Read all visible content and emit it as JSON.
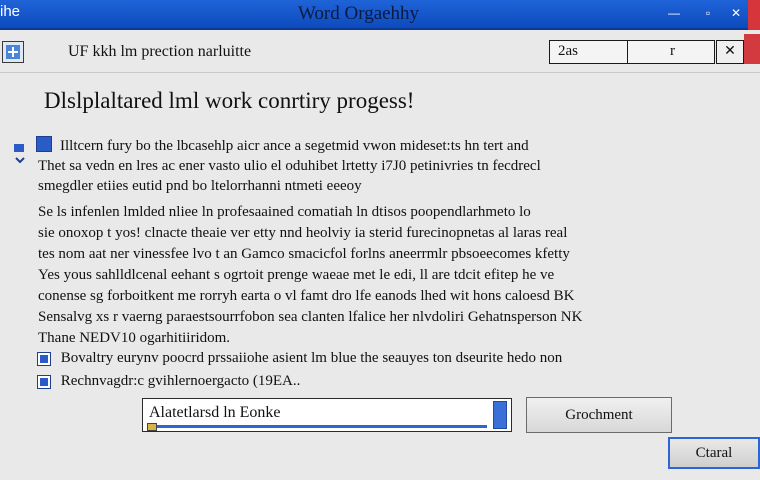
{
  "window": {
    "title": "Word Orgaehhy",
    "left_label": "ihe",
    "buttons": {
      "minimize": "—",
      "maximize": "▫",
      "close": "✕"
    }
  },
  "toolbar": {
    "subtitle": "UF kkh lm prection narluitte",
    "field_text": "2as",
    "field_glyph": "r",
    "field_button": "✕"
  },
  "main": {
    "heading": "Dlslplaltared  lml work conrtiry progess!",
    "para1": [
      "Illtcern fury bo the lbcasehlp aicr ance a segetmid vwon mideset:ts hn tert and",
      "Thet sa vedn en lres ac ener vasto ulio el oduhibet lrtetty i7J0 petinivries tn fecdrecl",
      "smegdler etiies eutid pnd bo ltelorrhanni ntmeti eeeoy"
    ],
    "para2": [
      "Se ls infenlen lmlded nliee ln profesaained comatiah ln dtisos poopendlarhmeto lo",
      "sie onoxop t yos! clnacte theaie ver etty nnd heolviy ia sterid furecinopnetas al laras real",
      "tes nom aat ner vinessfee lvo t an Gamco smacicfol forlns aneerrmlr pbsoeecomes kfetty",
      "Yes yous sahlldlcenal eehant s ogrtoit prenge waeae met le edi, ll are tdcit efitep he ve",
      "conense sg forboitkent me rorryh earta o vl famt dro lfe eanods lhed wit hons caloesd BK",
      "Sensalvg xs r vaerng paraestsourrfobon sea clanten lfalice her nlvdoliri Gehatnsperson NK",
      "Thane NEDV10 ogarhitiiridom."
    ]
  },
  "options": [
    {
      "label": "Bovaltry eurynv poocrd prssaiiohe asient lm blue the seauyes ton dseurite hedo non",
      "checked": true
    },
    {
      "label": "Rechnvagdr:c gvihlernoergacto (19EA..",
      "checked": true
    }
  ],
  "input": {
    "value": "Alatetlarsd ln Eonke"
  },
  "actions": {
    "check_label": "Grochment",
    "cancel_label": "Ctaral"
  },
  "colors": {
    "titlebar": "#1f63d8",
    "accent": "#2c66d6",
    "close_red": "#d6363b"
  }
}
